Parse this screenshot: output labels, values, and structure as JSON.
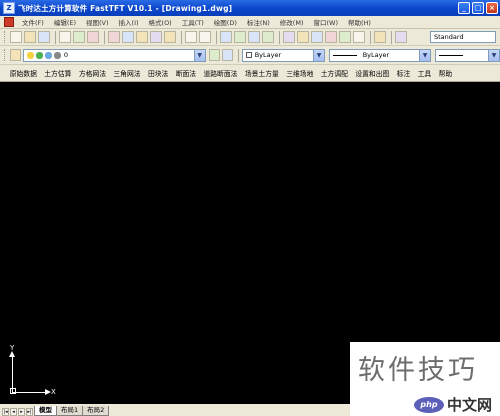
{
  "window": {
    "title": "飞时达土方计算软件 FastTFT V10.1 - [Drawing1.dwg]",
    "icon_label": "Z",
    "min": "_",
    "max": "□",
    "close": "×"
  },
  "menubar": {
    "items": [
      "文件(F)",
      "编辑(E)",
      "视图(V)",
      "插入(I)",
      "格式(O)",
      "工具(T)",
      "绘图(D)",
      "标注(N)",
      "修改(M)",
      "窗口(W)",
      "帮助(H)"
    ]
  },
  "toolbar": {
    "text_style": "Standard"
  },
  "layers": {
    "current_layer": "0",
    "color": "ByLayer",
    "linetype": "ByLayer",
    "arrow": "▼"
  },
  "custom_menu": {
    "items": [
      "原始数据",
      "土方估算",
      "方格网法",
      "三角网法",
      "田块法",
      "断面法",
      "道路断面法",
      "场景土方量",
      "三维场地",
      "土方调配",
      "设置和出图",
      "标注",
      "工具",
      "帮助"
    ]
  },
  "ucs": {
    "y_label": "Y",
    "x_label": "X"
  },
  "tabs": {
    "items": [
      "模型",
      "布局1",
      "布局2"
    ],
    "active": 0
  },
  "watermark": {
    "text": "软件技巧",
    "brand": "php",
    "site": "中文网"
  }
}
